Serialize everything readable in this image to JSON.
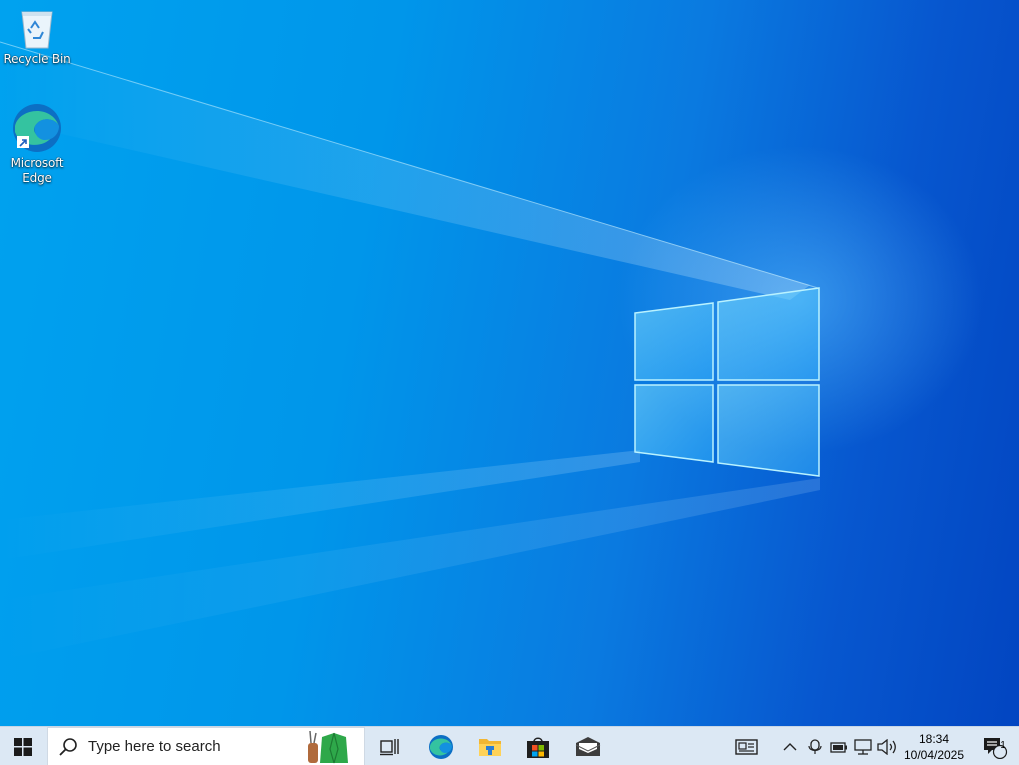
{
  "desktop": {
    "icons": [
      {
        "label": "Recycle Bin",
        "icon": "recycle-bin-icon"
      },
      {
        "label": "Microsoft Edge",
        "icon": "edge-icon"
      }
    ]
  },
  "taskbar": {
    "start_icon": "windows-logo-icon",
    "search": {
      "placeholder": "Type here to search",
      "icon": "search-icon",
      "highlight_icon": "search-highlight-golf-icon"
    },
    "pinned": [
      {
        "name": "Task View",
        "icon": "task-view-icon"
      },
      {
        "name": "Microsoft Edge",
        "icon": "edge-icon"
      },
      {
        "name": "File Explorer",
        "icon": "folder-icon"
      },
      {
        "name": "Microsoft Store",
        "icon": "store-icon"
      },
      {
        "name": "Mail",
        "icon": "mail-icon"
      }
    ],
    "tray": {
      "icons": [
        "news-and-interests-icon",
        "chevron-up-icon",
        "meet-now-icon",
        "battery-icon",
        "network-icon",
        "volume-icon"
      ],
      "time": "18:34",
      "date": "10/04/2025",
      "notification_count": "1"
    }
  },
  "colors": {
    "taskbar_bg": "#dce8f4",
    "desktop_left": "#00a2ef",
    "desktop_right": "#0245c1"
  }
}
